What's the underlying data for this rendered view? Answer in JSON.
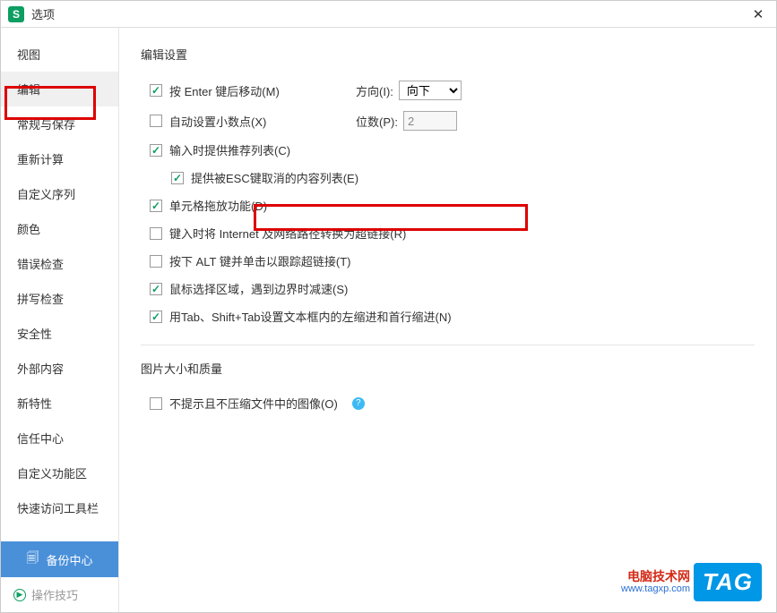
{
  "titlebar": {
    "app_letter": "S",
    "title": "选项"
  },
  "sidebar": {
    "items": [
      {
        "label": "视图"
      },
      {
        "label": "编辑"
      },
      {
        "label": "常规与保存"
      },
      {
        "label": "重新计算"
      },
      {
        "label": "自定义序列"
      },
      {
        "label": "颜色"
      },
      {
        "label": "错误检查"
      },
      {
        "label": "拼写检查"
      },
      {
        "label": "安全性"
      },
      {
        "label": "外部内容"
      },
      {
        "label": "新特性"
      },
      {
        "label": "信任中心"
      },
      {
        "label": "自定义功能区"
      },
      {
        "label": "快速访问工具栏"
      }
    ],
    "backup_label": "备份中心",
    "tips_label": "操作技巧"
  },
  "content": {
    "section1_title": "编辑设置",
    "row_enter": {
      "label": "按 Enter 键后移动(M)"
    },
    "direction_label": "方向(I):",
    "direction_value": "向下",
    "row_decimal": {
      "label": "自动设置小数点(X)"
    },
    "digits_label": "位数(P):",
    "digits_value": "2",
    "row_recommend": {
      "label": "输入时提供推荐列表(C)"
    },
    "row_esc": {
      "label": "提供被ESC键取消的内容列表(E)"
    },
    "row_drag": {
      "label": "单元格拖放功能(D)"
    },
    "row_hyperlink": {
      "label": "键入时将 Internet 及网络路径转换为超链接(R)"
    },
    "row_alt": {
      "label": "按下 ALT 键并单击以跟踪超链接(T)"
    },
    "row_mouse": {
      "label": "鼠标选择区域，遇到边界时减速(S)"
    },
    "row_tab": {
      "label": "用Tab、Shift+Tab设置文本框内的左缩进和首行缩进(N)"
    },
    "section2_title": "图片大小和质量",
    "row_image": {
      "label": "不提示且不压缩文件中的图像(O)"
    }
  },
  "watermark": {
    "line1": "电脑技术网",
    "line2": "www.tagxp.com",
    "tag": "TAG"
  }
}
